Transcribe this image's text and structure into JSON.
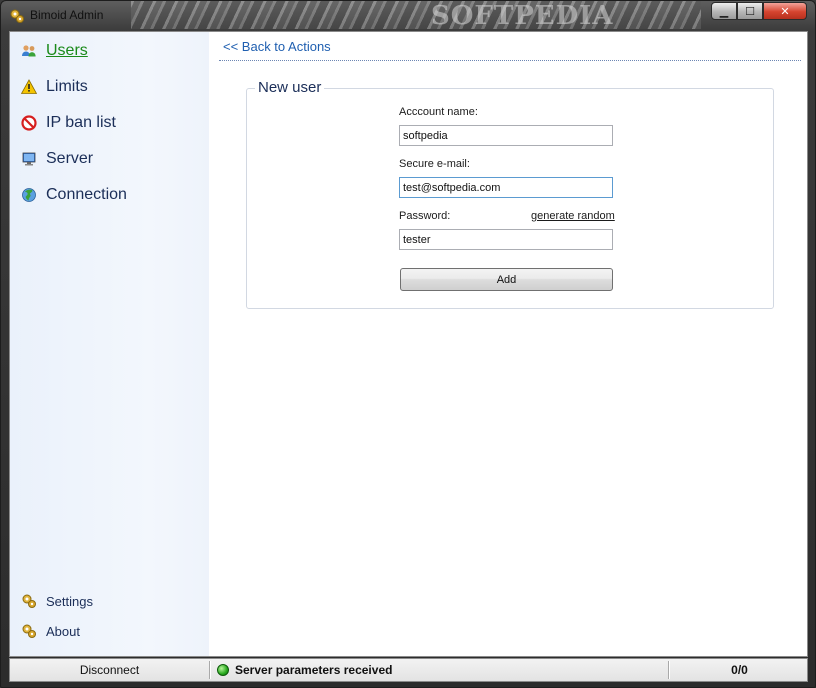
{
  "window": {
    "title": "Bimoid Admin",
    "watermark": "SOFTPEDIA"
  },
  "titlebar": {
    "minimize_glyph": "▁",
    "maximize_glyph": "☐",
    "close_glyph": "✕"
  },
  "sidebar": {
    "items": [
      {
        "label": "Users",
        "icon": "users-icon",
        "active": true
      },
      {
        "label": "Limits",
        "icon": "warning-icon"
      },
      {
        "label": "IP ban list",
        "icon": "ban-icon"
      },
      {
        "label": "Server",
        "icon": "monitor-icon"
      },
      {
        "label": "Connection",
        "icon": "globe-icon"
      }
    ],
    "bottom_items": [
      {
        "label": "Settings",
        "icon": "gears-icon"
      },
      {
        "label": "About",
        "icon": "gears-icon"
      }
    ]
  },
  "main": {
    "back_link": "<< Back to Actions",
    "form": {
      "title": "New user",
      "account_label": "Acccount name:",
      "account_value": "softpedia",
      "email_label": "Secure e-mail:",
      "email_value": "test@softpedia.com",
      "password_label": "Password:",
      "generate_label": "generate random",
      "password_value": "tester",
      "add_label": "Add"
    }
  },
  "statusbar": {
    "disconnect_label": "Disconnect",
    "status_text": "Server parameters received",
    "counter": "0/0"
  },
  "colors": {
    "accent_link": "#1f5fb0",
    "active_nav": "#1a8a1a",
    "status_ok": "#27a91d"
  }
}
